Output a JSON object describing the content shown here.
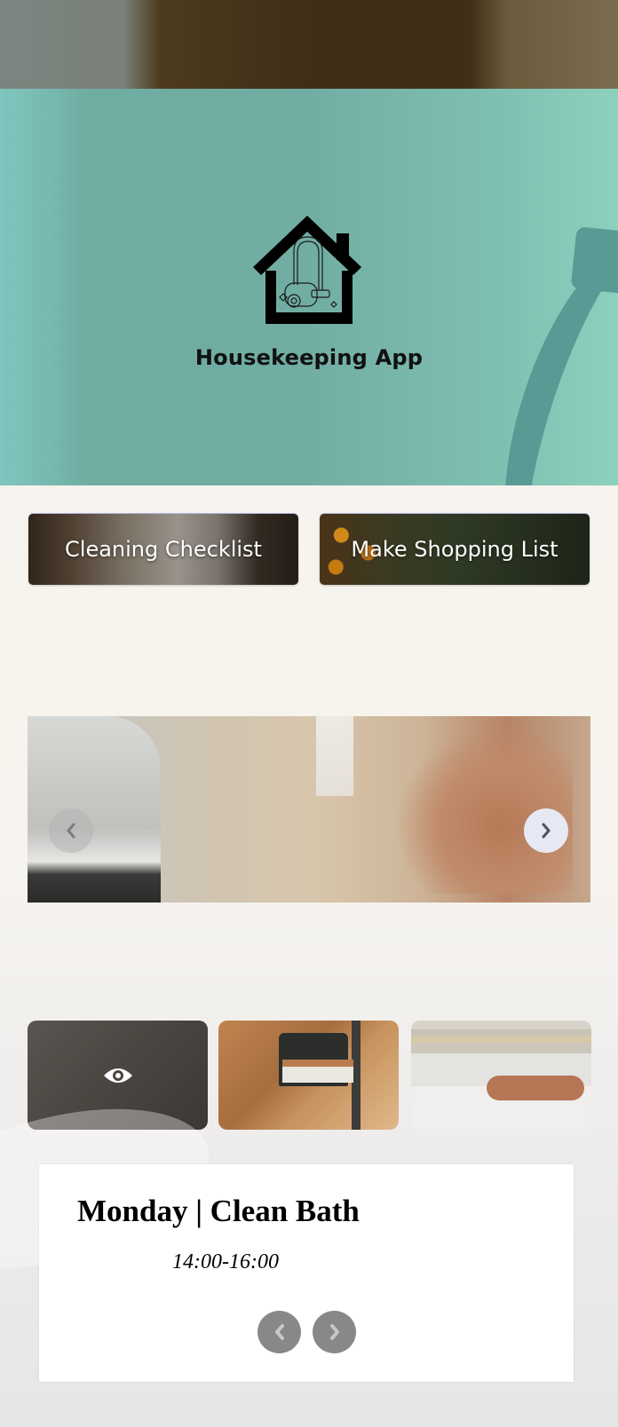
{
  "app": {
    "title": "Housekeeping App",
    "logo_icon": "house-vacuum-icon"
  },
  "actions": {
    "cleaning_checklist": "Cleaning Checklist",
    "make_shopping_list": "Make Shopping List"
  },
  "slider": {
    "prev_icon": "chevron-left-icon",
    "next_icon": "chevron-right-icon",
    "current_slide": "ironing-cloth"
  },
  "gallery": {
    "thumbnails": [
      {
        "subject": "ironing-cloth",
        "overlay_icon": "eye-icon",
        "active": true
      },
      {
        "subject": "dustpan-and-brush",
        "active": false
      },
      {
        "subject": "wiping-table",
        "active": false
      }
    ]
  },
  "schedule": {
    "title": "Monday | Clean Bath",
    "time": "14:00-16:00",
    "prev_icon": "chevron-left-icon",
    "next_icon": "chevron-right-icon"
  },
  "colors": {
    "hero_teal": "#71ada3",
    "accent_deco": "#5a9a95",
    "page_bg": "#f6f2ec",
    "card_arrow": "#888888"
  }
}
